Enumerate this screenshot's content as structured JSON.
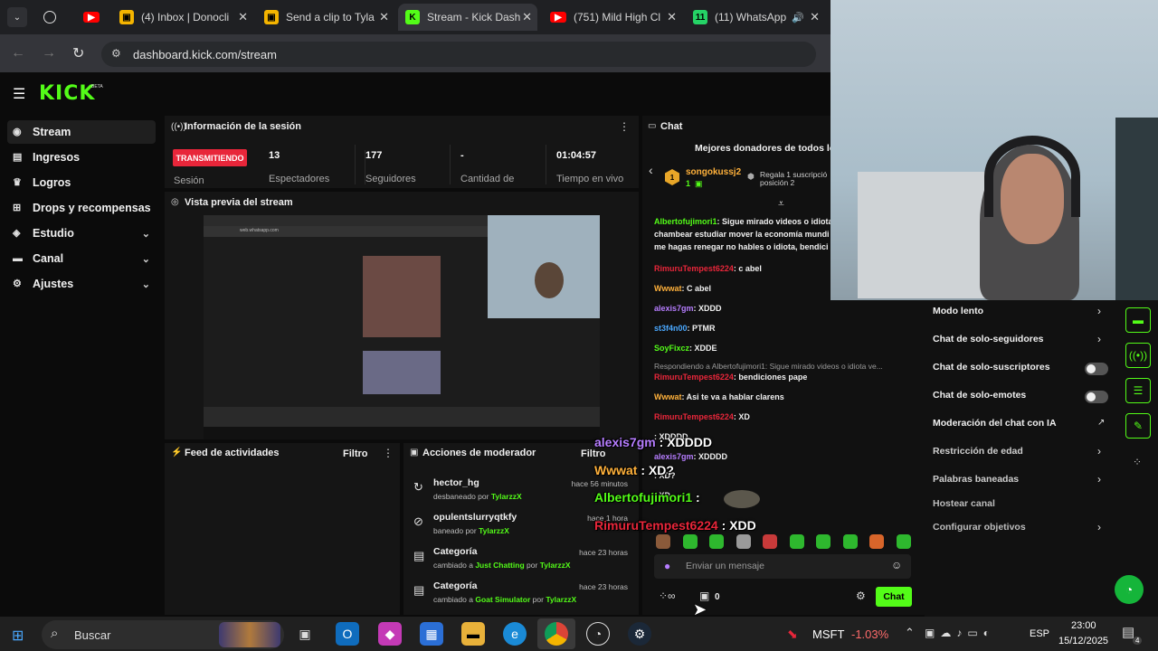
{
  "browser": {
    "tabs": [
      {
        "label": "",
        "icon": "openai-icon"
      },
      {
        "label": "",
        "icon": "youtube-icon"
      },
      {
        "label": "(4) Inbox | Donocli",
        "icon": "mail-icon"
      },
      {
        "label": "Send a clip to Tyla",
        "icon": "mail-icon"
      },
      {
        "label": "Stream - Kick Dash",
        "icon": "kick-icon",
        "active": true
      },
      {
        "label": "(751) Mild High Cl",
        "icon": "youtube-icon"
      },
      {
        "label": "(11) WhatsApp",
        "icon": "whatsapp-icon"
      }
    ],
    "url": "dashboard.kick.com/stream"
  },
  "logo": "KICK",
  "logo_badge": "BETA",
  "sidebar": {
    "items": [
      {
        "label": "Stream",
        "icon": "stream-icon",
        "active": true
      },
      {
        "label": "Ingresos",
        "icon": "money-icon"
      },
      {
        "label": "Logros",
        "icon": "trophy-icon"
      },
      {
        "label": "Drops y recompensas",
        "icon": "gift-icon"
      },
      {
        "label": "Estudio",
        "icon": "studio-icon",
        "expandable": true
      },
      {
        "label": "Canal",
        "icon": "channel-icon",
        "expandable": true
      },
      {
        "label": "Ajustes",
        "icon": "gear-icon",
        "expandable": true
      }
    ]
  },
  "session": {
    "title": "Información de la sesión",
    "live_badge": "TRANSMITIENDO",
    "live_label": "Sesión",
    "stats": [
      {
        "value": "13",
        "label": "Espectadores"
      },
      {
        "value": "177",
        "label": "Seguidores"
      },
      {
        "value": "-",
        "label": "Cantidad de"
      },
      {
        "value": "01:04:57",
        "label": "Tiempo en vivo"
      }
    ]
  },
  "preview": {
    "title": "Vista previa del stream",
    "screen_caption": "web.whatsapp.com"
  },
  "activity": {
    "title": "Feed de actividades",
    "filter": "Filtro"
  },
  "mod_actions": {
    "title": "Acciones de moderador",
    "filter": "Filtro",
    "rows": [
      {
        "title": "hector_hg",
        "action": "desbaneado por",
        "user": "TylarzzX",
        "time": "hace 56 minutos",
        "icon": "unban-icon"
      },
      {
        "title": "opulentslurryqtkfy",
        "action": "baneado por",
        "user": "TylarzzX",
        "time": "hace 1 hora",
        "icon": "ban-icon"
      },
      {
        "title": "Categoría",
        "action": "cambiado a",
        "target": "Just Chatting",
        "by": "por",
        "user": "TylarzzX",
        "time": "hace 23 horas",
        "icon": "category-icon"
      },
      {
        "title": "Categoría",
        "action": "cambiado a",
        "target": "Goat Simulator",
        "by": "por",
        "user": "TylarzzX",
        "time": "hace 23 horas",
        "icon": "category-icon"
      }
    ]
  },
  "chat": {
    "title": "Chat",
    "donors_title": "Mejores donadores de todos los",
    "donor": {
      "name": "songokussj2",
      "count": "1",
      "note": "Regala 1 suscripció",
      "position": "posición 2"
    },
    "messages": [
      {
        "user": "Albertofujimori1",
        "color": "#53fc18",
        "text": ": Sigue mirado videos o idiota"
      },
      {
        "user": "",
        "color": "#f0f0f0",
        "text": "chambear estudiar mover la economía mundi"
      },
      {
        "user": "",
        "color": "#f0f0f0",
        "text": "me hagas renegar no hables o idiota, bendici"
      },
      {
        "user": "RimuruTempest6224",
        "color": "#e8263a",
        "text": ": c abel"
      },
      {
        "user": "Wwwat",
        "color": "#ffb13b",
        "text": ": C abel"
      },
      {
        "user": "alexis7gm",
        "color": "#b67dff",
        "text": ": XDDD"
      },
      {
        "user": "st3f4n00",
        "color": "#4aa8ff",
        "text": ": PTMR"
      },
      {
        "user": "SoyFixcz",
        "color": "#53fc18",
        "text": ": XDDE"
      },
      {
        "user": "",
        "color": "#9a9a9a",
        "text": "Respondiendo a Albertofujimori1: Sigue mirado videos o idiota ve..."
      },
      {
        "user": "RimuruTempest6224",
        "color": "#e8263a",
        "text": ": bendiciones pape"
      },
      {
        "user": "Wwwat",
        "color": "#ffb13b",
        "text": ": Asi te va a hablar clarens"
      },
      {
        "user": "RimuruTempest6224",
        "color": "#e8263a",
        "text": ": XD"
      },
      {
        "user": "",
        "color": "#f0f0f0",
        "text": ": XDDDD"
      },
      {
        "user": "alexis7gm",
        "color": "#b67dff",
        "text": ": XDDDD"
      },
      {
        "user": "",
        "color": "#f0f0f0",
        "text": ": XD?"
      },
      {
        "user": "",
        "color": "#f0f0f0",
        "text": ": XD"
      }
    ],
    "overlay": [
      {
        "user": "alexis7gm",
        "color": "#b67dff",
        "text": " : XDDDD"
      },
      {
        "user": "Wwwat",
        "color": "#ffb13b",
        "text": " : XD?"
      },
      {
        "user": "Albertofujimori1",
        "color": "#53fc18",
        "text": " :"
      },
      {
        "user": "RimuruTempest6224",
        "color": "#e8263a",
        "text": " : XDD"
      }
    ],
    "input_placeholder": "Enviar un mensaje",
    "points": "0",
    "send": "Chat"
  },
  "chat_menu": {
    "items": [
      {
        "label": "Modo lento",
        "type": "chevron"
      },
      {
        "label": "Chat de solo-seguidores",
        "type": "chevron"
      },
      {
        "label": "Chat de solo-suscriptores",
        "type": "toggle"
      },
      {
        "label": "Chat de solo-emotes",
        "type": "toggle"
      },
      {
        "label": "Moderación del chat con IA",
        "type": "external"
      },
      {
        "label": "Restricción de edad",
        "type": "chevron"
      },
      {
        "label": "Palabras baneadas",
        "type": "chevron"
      },
      {
        "label": "Hostear canal",
        "type": "none"
      },
      {
        "label": "Configurar objetivos",
        "type": "chevron"
      }
    ]
  },
  "taskbar": {
    "search": "Buscar",
    "stock": {
      "symbol": "MSFT",
      "change": "-1.03%"
    },
    "lang": "ESP",
    "time": "23:00",
    "date": "15/12/2025",
    "notif": "4"
  },
  "colors": {
    "kick_green": "#53fc18",
    "live_red": "#e8263a",
    "panel": "#151515"
  }
}
